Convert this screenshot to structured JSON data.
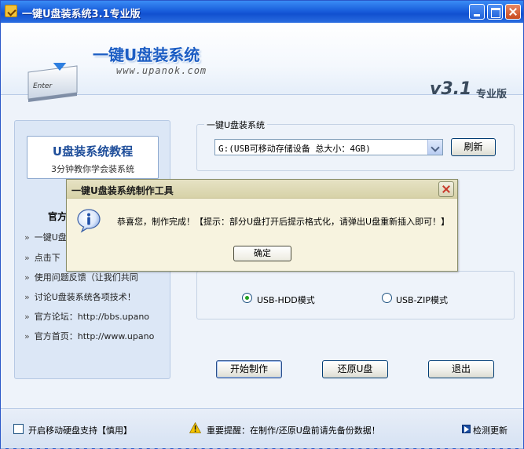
{
  "window": {
    "title": "一键U盘装系统3.1专业版"
  },
  "header": {
    "enter_key_label": "Enter",
    "logo_title": "一键U盘装系统",
    "logo_url": "www.upanok.com",
    "version": "v3.1",
    "edition": "专业版"
  },
  "sidebar": {
    "tutorial_title": "U盘装系统教程",
    "tutorial_subtitle": "3分钟教你学会装系统",
    "official_label": "官方",
    "links": [
      {
        "bullet": "»",
        "text": "一键U盘"
      },
      {
        "bullet": "»",
        "text": "点击下"
      },
      {
        "bullet": "»",
        "text": "使用问题反馈（让我们共同"
      },
      {
        "bullet": "»",
        "text": "讨论U盘装系统各项技术！"
      },
      {
        "bullet": "»",
        "text": "官方论坛：http://bbs.upano"
      },
      {
        "bullet": "»",
        "text": "官方首页：http://www.upano"
      }
    ]
  },
  "drive_group": {
    "label": "一键U盘装系统",
    "selected_drive": "G:(USB可移动存储设备 总大小：4GB)",
    "refresh_label": "刷新"
  },
  "mode_group": {
    "options": [
      {
        "label": "USB-HDD模式",
        "selected": true
      },
      {
        "label": "USB-ZIP模式",
        "selected": false
      }
    ]
  },
  "actions": {
    "start_label": "开始制作",
    "restore_label": "还原U盘",
    "exit_label": "退出"
  },
  "footer": {
    "checkbox_label": "开启移动硬盘支持【慎用】",
    "checkbox_checked": false,
    "warning_text": "重要提醒：在制作/还原U盘前请先备份数据！",
    "update_label": "检测更新"
  },
  "dialog": {
    "title": "一键U盘装系统制作工具",
    "message": "恭喜您，制作完成！【提示：部分U盘打开后提示格式化，请弹出U盘重新插入即可！】",
    "ok_label": "确定"
  },
  "colors": {
    "titlebar_blue": "#1a5fdc",
    "logo_blue": "#1d5ec4",
    "dialog_bg": "#f7f3df",
    "radio_green": "#21a121"
  }
}
